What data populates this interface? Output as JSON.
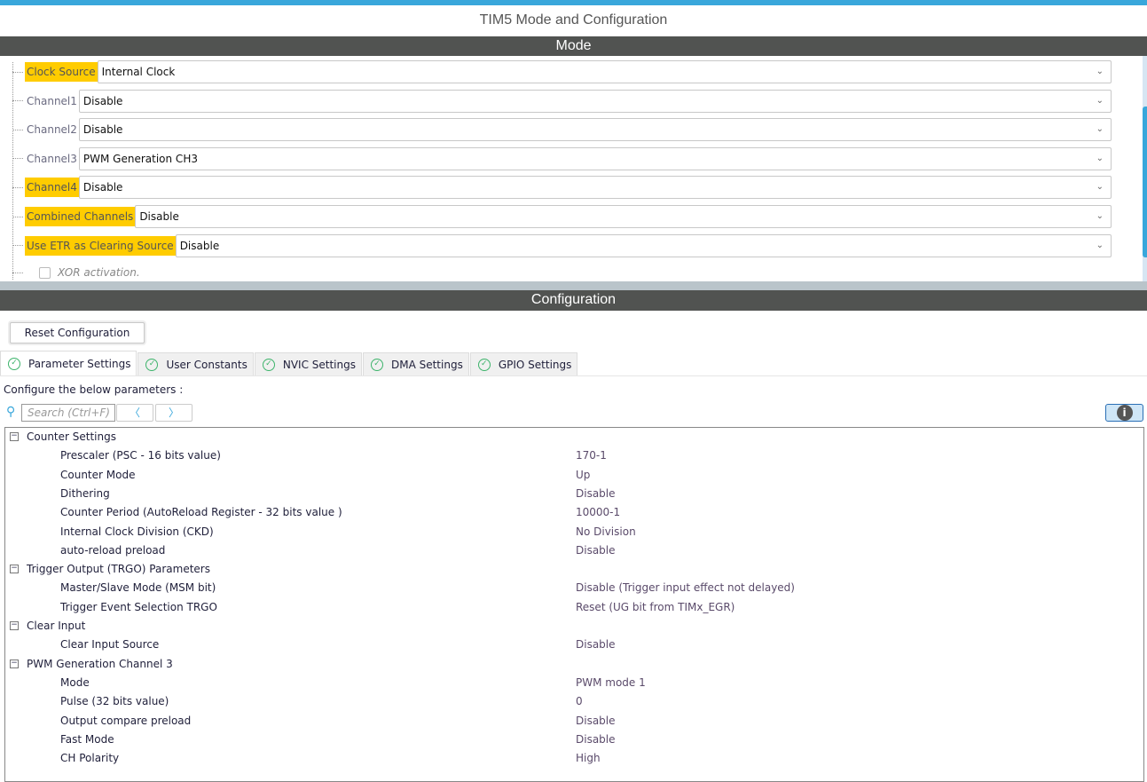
{
  "title": "TIM5 Mode and Configuration",
  "mode": {
    "header": "Mode",
    "rows": [
      {
        "label": "Clock Source",
        "value": "Internal Clock",
        "highlight": true
      },
      {
        "label": "Channel1",
        "value": "Disable",
        "highlight": false
      },
      {
        "label": "Channel2",
        "value": "Disable",
        "highlight": false
      },
      {
        "label": "Channel3",
        "value": "PWM Generation CH3",
        "highlight": false
      },
      {
        "label": "Channel4",
        "value": "Disable",
        "highlight": true
      },
      {
        "label": "Combined Channels",
        "value": "Disable",
        "highlight": true
      },
      {
        "label": "Use ETR as Clearing Source",
        "value": "Disable",
        "highlight": true
      }
    ],
    "xor_label": "XOR activation."
  },
  "config": {
    "header": "Configuration",
    "reset_label": "Reset Configuration",
    "tabs": [
      "Parameter Settings",
      "User Constants",
      "NVIC Settings",
      "DMA Settings",
      "GPIO Settings"
    ],
    "instructions": "Configure the below parameters :",
    "search_placeholder": "Search (Ctrl+F)",
    "tree": [
      {
        "group": "Counter Settings",
        "items": [
          [
            "Prescaler (PSC - 16 bits value)",
            "170-1"
          ],
          [
            "Counter Mode",
            "Up"
          ],
          [
            "Dithering",
            "Disable"
          ],
          [
            "Counter Period (AutoReload Register - 32 bits value )",
            "10000-1"
          ],
          [
            "Internal Clock Division (CKD)",
            "No Division"
          ],
          [
            "auto-reload preload",
            "Disable"
          ]
        ]
      },
      {
        "group": "Trigger Output (TRGO) Parameters",
        "items": [
          [
            "Master/Slave Mode (MSM bit)",
            "Disable (Trigger input effect not delayed)"
          ],
          [
            "Trigger Event Selection TRGO",
            "Reset (UG bit from TIMx_EGR)"
          ]
        ]
      },
      {
        "group": "Clear Input",
        "items": [
          [
            "Clear Input Source",
            "Disable"
          ]
        ]
      },
      {
        "group": "PWM Generation Channel 3",
        "items": [
          [
            "Mode",
            "PWM mode 1"
          ],
          [
            "Pulse (32 bits value)",
            "0"
          ],
          [
            "Output compare preload",
            "Disable"
          ],
          [
            "Fast Mode",
            "Disable"
          ],
          [
            "CH Polarity",
            "High"
          ]
        ]
      }
    ]
  },
  "colors": {
    "accent": "#39a7db",
    "highlight": "#ffcc00",
    "header": "#515351"
  }
}
